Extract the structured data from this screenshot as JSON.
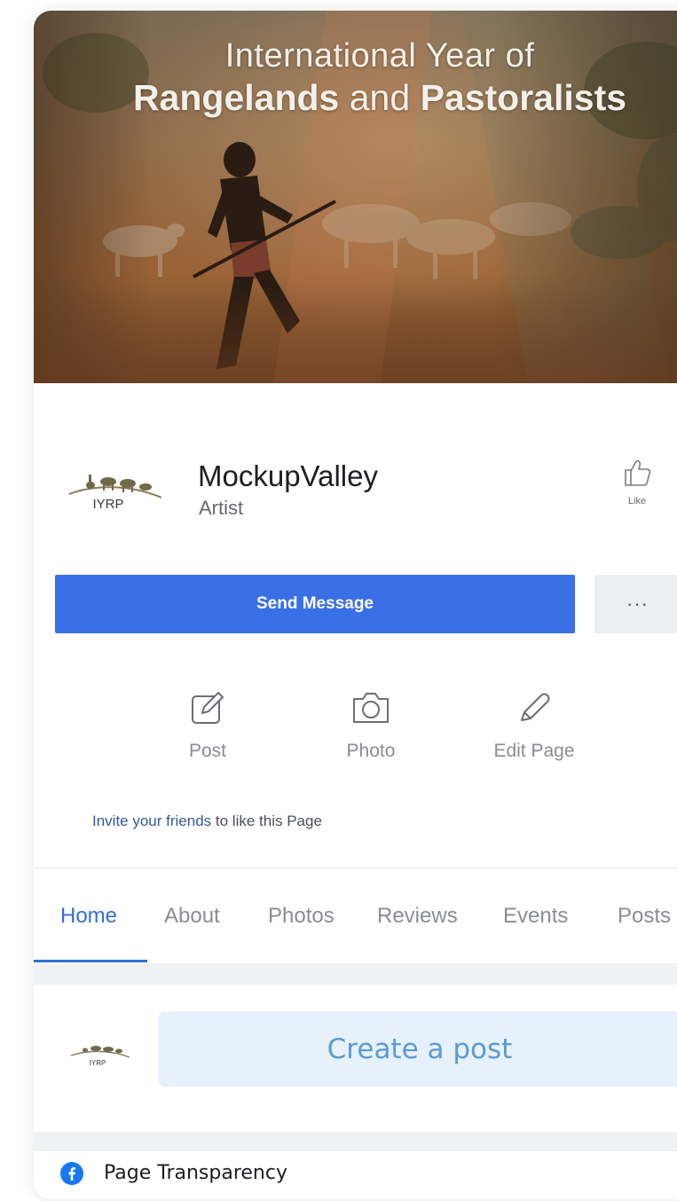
{
  "cover": {
    "title_line1": "International Year of",
    "title_word1": "Rangelands",
    "title_word2": "and",
    "title_word3": "Pastoralists"
  },
  "profile": {
    "logo_text": "IYRP",
    "name": "MockupValley",
    "category": "Artist",
    "like_label": "Like",
    "send_message_label": "Send Message",
    "more_label": "···"
  },
  "actions": [
    {
      "label": "Post",
      "icon": "compose-icon"
    },
    {
      "label": "Photo",
      "icon": "camera-icon"
    },
    {
      "label": "Edit Page",
      "icon": "pencil-icon"
    }
  ],
  "invite": {
    "link_text": "Invite your friends",
    "rest_text": " to like this Page"
  },
  "tabs": [
    {
      "label": "Home",
      "active": true
    },
    {
      "label": "About"
    },
    {
      "label": "Photos"
    },
    {
      "label": "Reviews"
    },
    {
      "label": "Events"
    },
    {
      "label": "Posts"
    }
  ],
  "composer": {
    "logo_text": "IYRP",
    "create_post_label": "Create a post"
  },
  "transparency": {
    "label": "Page Transparency"
  },
  "colors": {
    "primary_button": "#3b6fe6",
    "active_tab": "#2f6fd6",
    "create_post_bg": "#e7f1fb",
    "facebook_blue": "#1877f2"
  }
}
